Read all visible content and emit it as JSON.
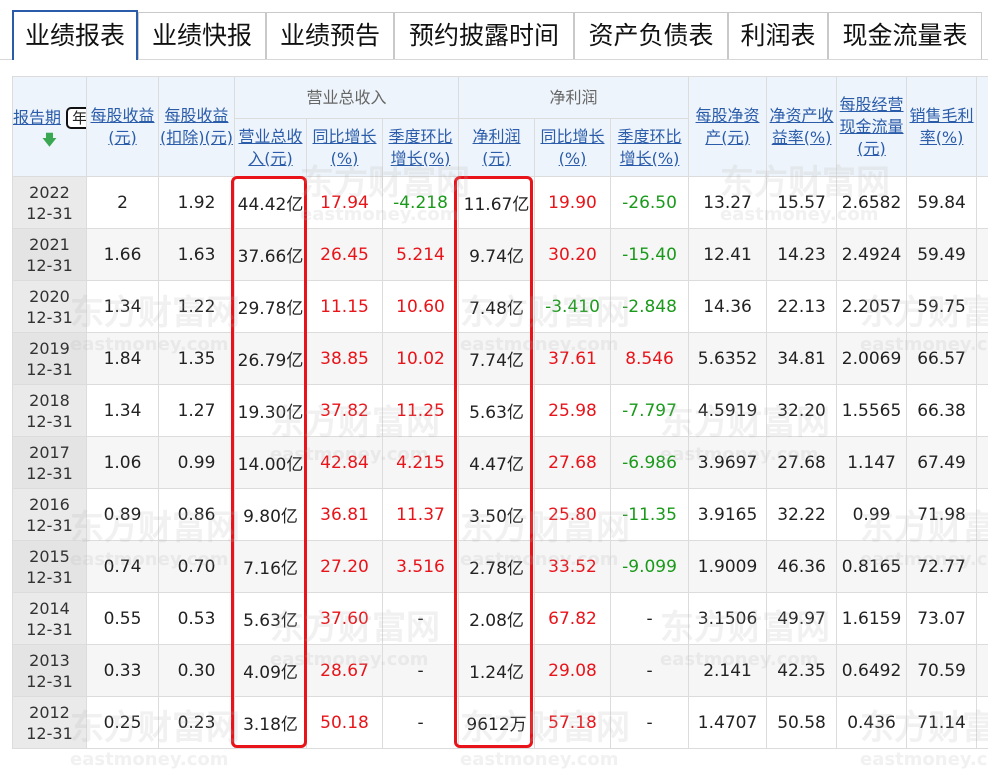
{
  "tabs": [
    {
      "label": "业绩报表",
      "active": true
    },
    {
      "label": "业绩快报",
      "active": false
    },
    {
      "label": "业绩预告",
      "active": false
    },
    {
      "label": "预约披露时间",
      "active": false
    },
    {
      "label": "资产负债表",
      "active": false
    },
    {
      "label": "利润表",
      "active": false
    },
    {
      "label": "现金流量表",
      "active": false
    }
  ],
  "header": {
    "period_label": "报告期",
    "period_select": "年报",
    "eps": "每股收益(元)",
    "eps_deducted": "每股收益(扣除)(元)",
    "revenue_group": "营业总收入",
    "revenue": "营业总收入(元)",
    "revenue_yoy": "同比增长(%)",
    "revenue_qoq": "季度环比增长(%)",
    "profit_group": "净利润",
    "profit": "净利润(元)",
    "profit_yoy": "同比增长(%)",
    "profit_qoq": "季度环比增长(%)",
    "bvps": "每股净资产(元)",
    "roe": "净资产收益率(%)",
    "ocfps": "每股经营现金流量(元)",
    "gross_margin": "销售毛利率(%)"
  },
  "watermark": {
    "cn": "东方财富网",
    "en": "eastmoney.com"
  },
  "highlight_color": "#e8141a",
  "rows": [
    {
      "year": "2022",
      "md": "12-31",
      "eps": "2",
      "eps_ded": "1.92",
      "rev": "44.42亿",
      "rev_yoy": "17.94",
      "rev_qoq": "-4.218",
      "np": "11.67亿",
      "np_yoy": "19.90",
      "np_qoq": "-26.50",
      "bvps": "13.27",
      "roe": "15.57",
      "ocf": "2.6582",
      "gm": "59.84"
    },
    {
      "year": "2021",
      "md": "12-31",
      "eps": "1.66",
      "eps_ded": "1.63",
      "rev": "37.66亿",
      "rev_yoy": "26.45",
      "rev_qoq": "5.214",
      "np": "9.74亿",
      "np_yoy": "30.20",
      "np_qoq": "-15.40",
      "bvps": "12.41",
      "roe": "14.23",
      "ocf": "2.4924",
      "gm": "59.49"
    },
    {
      "year": "2020",
      "md": "12-31",
      "eps": "1.34",
      "eps_ded": "1.22",
      "rev": "29.78亿",
      "rev_yoy": "11.15",
      "rev_qoq": "10.60",
      "np": "7.48亿",
      "np_yoy": "-3.410",
      "np_qoq": "-2.848",
      "bvps": "14.36",
      "roe": "22.13",
      "ocf": "2.2057",
      "gm": "59.75"
    },
    {
      "year": "2019",
      "md": "12-31",
      "eps": "1.84",
      "eps_ded": "1.35",
      "rev": "26.79亿",
      "rev_yoy": "38.85",
      "rev_qoq": "10.02",
      "np": "7.74亿",
      "np_yoy": "37.61",
      "np_qoq": "8.546",
      "bvps": "5.6352",
      "roe": "34.81",
      "ocf": "2.0069",
      "gm": "66.57"
    },
    {
      "year": "2018",
      "md": "12-31",
      "eps": "1.34",
      "eps_ded": "1.27",
      "rev": "19.30亿",
      "rev_yoy": "37.82",
      "rev_qoq": "11.25",
      "np": "5.63亿",
      "np_yoy": "25.98",
      "np_qoq": "-7.797",
      "bvps": "4.5919",
      "roe": "32.20",
      "ocf": "1.5565",
      "gm": "66.38"
    },
    {
      "year": "2017",
      "md": "12-31",
      "eps": "1.06",
      "eps_ded": "0.99",
      "rev": "14.00亿",
      "rev_yoy": "42.84",
      "rev_qoq": "4.215",
      "np": "4.47亿",
      "np_yoy": "27.68",
      "np_qoq": "-6.986",
      "bvps": "3.9697",
      "roe": "27.68",
      "ocf": "1.147",
      "gm": "67.49"
    },
    {
      "year": "2016",
      "md": "12-31",
      "eps": "0.89",
      "eps_ded": "0.86",
      "rev": "9.80亿",
      "rev_yoy": "36.81",
      "rev_qoq": "11.37",
      "np": "3.50亿",
      "np_yoy": "25.80",
      "np_qoq": "-11.35",
      "bvps": "3.9165",
      "roe": "32.22",
      "ocf": "0.99",
      "gm": "71.98"
    },
    {
      "year": "2015",
      "md": "12-31",
      "eps": "0.74",
      "eps_ded": "0.70",
      "rev": "7.16亿",
      "rev_yoy": "27.20",
      "rev_qoq": "3.516",
      "np": "2.78亿",
      "np_yoy": "33.52",
      "np_qoq": "-9.099",
      "bvps": "1.9009",
      "roe": "46.36",
      "ocf": "0.8165",
      "gm": "72.77"
    },
    {
      "year": "2014",
      "md": "12-31",
      "eps": "0.55",
      "eps_ded": "0.53",
      "rev": "5.63亿",
      "rev_yoy": "37.60",
      "rev_qoq": "-",
      "np": "2.08亿",
      "np_yoy": "67.82",
      "np_qoq": "-",
      "bvps": "3.1506",
      "roe": "49.97",
      "ocf": "1.6159",
      "gm": "73.07"
    },
    {
      "year": "2013",
      "md": "12-31",
      "eps": "0.33",
      "eps_ded": "0.30",
      "rev": "4.09亿",
      "rev_yoy": "28.67",
      "rev_qoq": "-",
      "np": "1.24亿",
      "np_yoy": "29.08",
      "np_qoq": "-",
      "bvps": "2.141",
      "roe": "42.35",
      "ocf": "0.6492",
      "gm": "70.59"
    },
    {
      "year": "2012",
      "md": "12-31",
      "eps": "0.25",
      "eps_ded": "0.23",
      "rev": "3.18亿",
      "rev_yoy": "50.18",
      "rev_qoq": "-",
      "np": "9612万",
      "np_yoy": "57.18",
      "np_qoq": "-",
      "bvps": "1.4707",
      "roe": "50.58",
      "ocf": "0.436",
      "gm": "71.14"
    }
  ]
}
